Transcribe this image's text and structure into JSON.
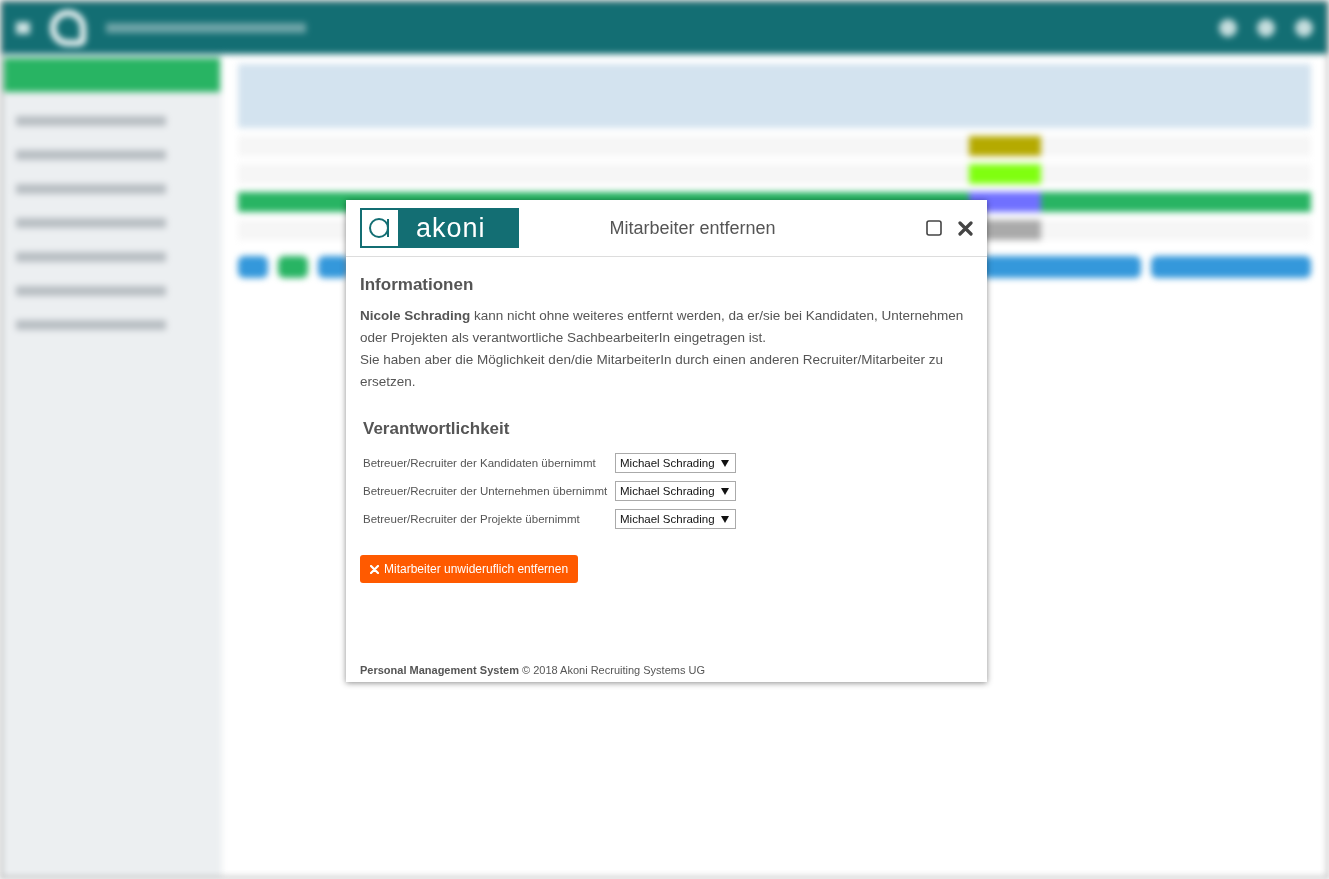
{
  "sidebar": {
    "items": [
      {
        "selected": true
      },
      {
        "selected": false
      },
      {
        "selected": false
      },
      {
        "selected": false
      },
      {
        "selected": false
      },
      {
        "selected": false
      },
      {
        "selected": false
      },
      {
        "selected": false
      }
    ]
  },
  "table": {
    "rows": [
      {
        "color": "#b5aa00",
        "selected": false
      },
      {
        "color": "#80ff10",
        "selected": false
      },
      {
        "color": "#7070ff",
        "selected": true
      },
      {
        "color": "#aaaaaa",
        "selected": false
      }
    ]
  },
  "dialog": {
    "logo_text": "akoni",
    "title": "Mitarbeiter entfernen",
    "info": {
      "heading": "Informationen",
      "lines": [
        "**Nicole Schrading** kann nicht ohne weiteres entfernt werden, da er/sie bei Kandidaten, Unternehmen oder Projekten als verantwortliche SachbearbeiterIn eingetragen ist.",
        "Sie haben aber die Möglichkeit den/die MitarbeiterIn durch einen anderen Recruiter/Mitarbeiter zu ersetzen."
      ]
    },
    "responsibility": {
      "heading": "Verantwortlichkeit",
      "rows": [
        {
          "label": "Betreuer/Recruiter der Kandidaten übernimmt",
          "value": "Michael Schrading"
        },
        {
          "label": "Betreuer/Recruiter der Unternehmen übernimmt",
          "value": "Michael Schrading"
        },
        {
          "label": "Betreuer/Recruiter der Projekte übernimmt",
          "value": "Michael Schrading"
        }
      ]
    },
    "remove_button": "Mitarbeiter unwideruflich entfernen",
    "footer": "**Personal Management System** © 2018 Akoni Recruiting Systems UG"
  }
}
